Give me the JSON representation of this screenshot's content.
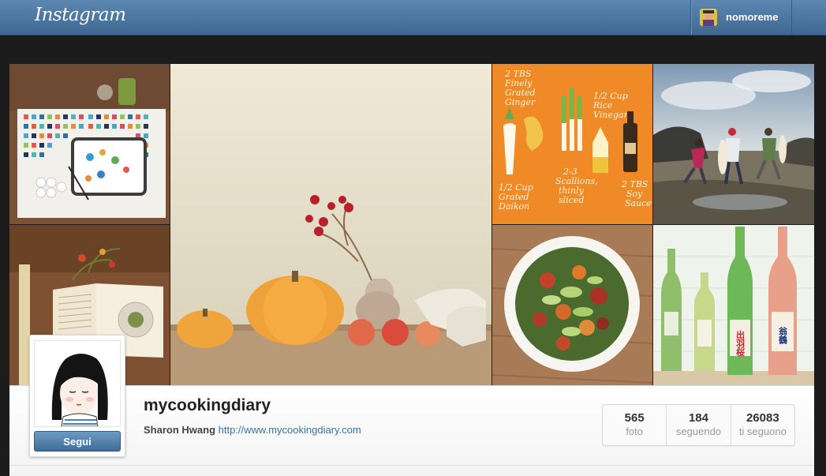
{
  "header": {
    "logo": "Instagram",
    "username": "nomoreme"
  },
  "profile": {
    "username": "mycookingdiary",
    "full_name": "Sharon Hwang",
    "website": "http://www.mycookingdiary.com",
    "follow_label": "Segui"
  },
  "stats": [
    {
      "value": "565",
      "label": "foto"
    },
    {
      "value": "184",
      "label": "seguendo"
    },
    {
      "value": "26083",
      "label": "ti seguono"
    }
  ],
  "recipe_card": {
    "line1": "2 TBS",
    "line2": "Finely",
    "line3": "Grated",
    "line4": "Ginger",
    "line5": "1/2 Cup",
    "line6": "Rice",
    "line7": "Vinegar",
    "line8": "2-3",
    "line9": "Scallions,",
    "line10": "thinly",
    "line11": "sliced",
    "line12": "1/2 Cup",
    "line13": "Grated",
    "line14": "Daikon",
    "line15": "2 TBS",
    "line16": "Soy",
    "line17": "Sauce"
  },
  "sake_labels": {
    "label1": "出羽桜",
    "label2": "翁鶴"
  }
}
